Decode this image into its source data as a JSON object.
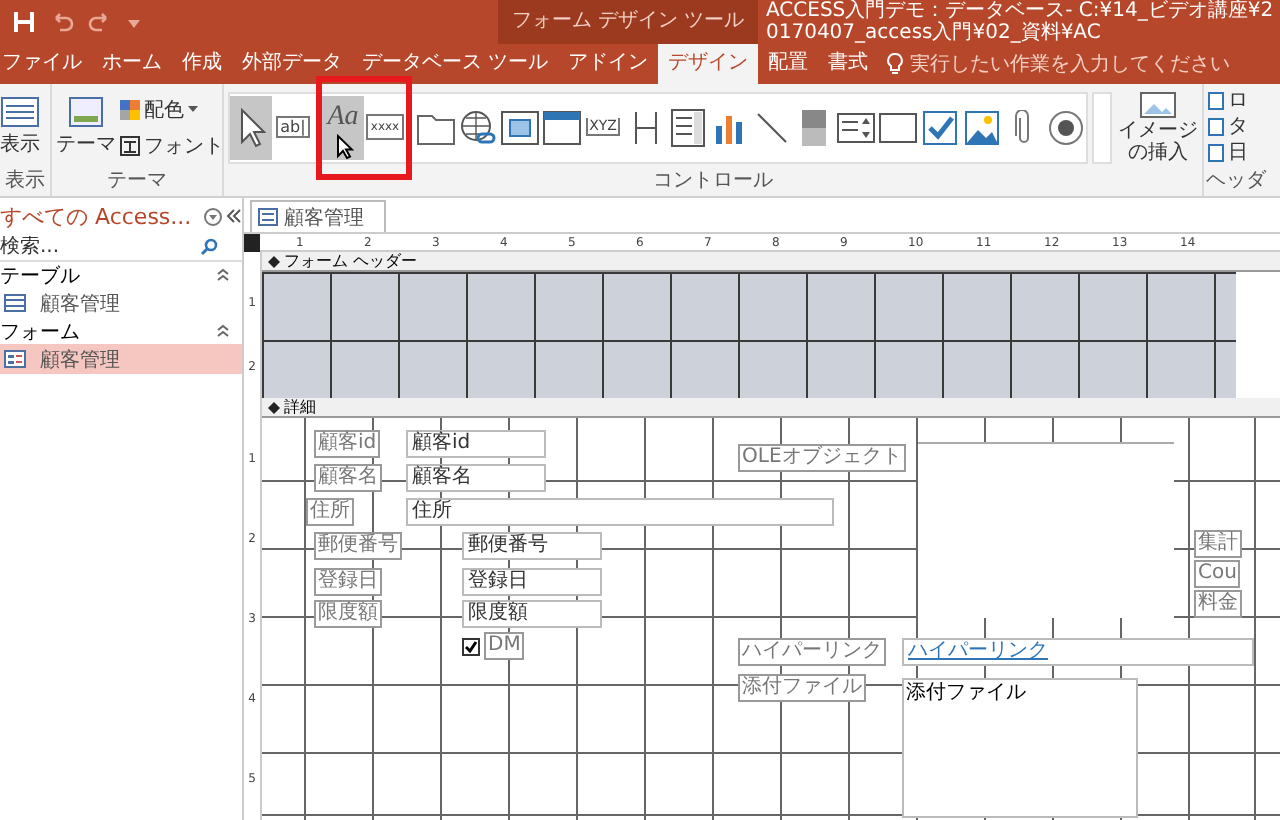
{
  "title_bar": {
    "context_title": "フォーム デザイン ツール",
    "document_title": "ACCESS入門デモ：データベース- C:¥14_ビデオ講座¥20170407_access入門¥02_資料¥AC"
  },
  "menu_tabs": [
    {
      "label": "ファイル",
      "selected": false
    },
    {
      "label": "ホーム",
      "selected": false
    },
    {
      "label": "作成",
      "selected": false
    },
    {
      "label": "外部データ",
      "selected": false
    },
    {
      "label": "データベース ツール",
      "selected": false
    },
    {
      "label": "アドイン",
      "selected": false
    },
    {
      "label": "デザイン",
      "selected": true
    },
    {
      "label": "配置",
      "selected": false
    },
    {
      "label": "書式",
      "selected": false
    }
  ],
  "tell_me": {
    "placeholder": "実行したい作業を入力してください"
  },
  "ribbon": {
    "view_group": {
      "button": "表示",
      "label": "表示"
    },
    "theme_group": {
      "theme_button": "テーマ",
      "colors_button": "配色",
      "fonts_button": "フォント",
      "label": "テーマ"
    },
    "controls_group": {
      "label": "コントロール",
      "items": [
        {
          "kind": "select",
          "selected": true,
          "highlighted": false,
          "hovered": false
        },
        {
          "kind": "textbox",
          "glyph": "ab|",
          "selected": false,
          "highlighted": false,
          "hovered": false
        },
        {
          "kind": "label",
          "glyph": "Aa",
          "selected": true,
          "highlighted": true,
          "hovered": true
        },
        {
          "kind": "button",
          "glyph": "xxxx",
          "selected": false,
          "highlighted": true,
          "hovered": false
        },
        {
          "kind": "tab",
          "selected": false,
          "highlighted": false,
          "hovered": false
        },
        {
          "kind": "hyperlink",
          "selected": false,
          "highlighted": false,
          "hovered": false
        },
        {
          "kind": "browser",
          "selected": false,
          "highlighted": false,
          "hovered": false
        },
        {
          "kind": "navigation",
          "selected": false,
          "highlighted": false,
          "hovered": false
        },
        {
          "kind": "option_group",
          "glyph": "XYZ",
          "selected": false,
          "highlighted": false,
          "hovered": false
        },
        {
          "kind": "page_break",
          "selected": false,
          "highlighted": false,
          "hovered": false
        },
        {
          "kind": "combo",
          "selected": false,
          "highlighted": false,
          "hovered": false
        },
        {
          "kind": "chart",
          "selected": false,
          "highlighted": false,
          "hovered": false
        },
        {
          "kind": "line",
          "selected": false,
          "highlighted": false,
          "hovered": false
        },
        {
          "kind": "toggle",
          "selected": false,
          "highlighted": false,
          "hovered": false
        },
        {
          "kind": "list",
          "selected": false,
          "highlighted": false,
          "hovered": false
        },
        {
          "kind": "rectangle",
          "selected": false,
          "highlighted": false,
          "hovered": false
        },
        {
          "kind": "checkbox",
          "selected": false,
          "highlighted": false,
          "hovered": false
        },
        {
          "kind": "image",
          "selected": false,
          "highlighted": false,
          "hovered": false
        },
        {
          "kind": "attachment",
          "selected": false,
          "highlighted": false,
          "hovered": false
        },
        {
          "kind": "radio",
          "selected": false,
          "highlighted": false,
          "hovered": false
        }
      ],
      "insert_image_button": "イメージの挿入"
    },
    "header_group": {
      "label": "ヘッダ",
      "items": [
        "ロ",
        "タ",
        "日"
      ]
    }
  },
  "nav_pane": {
    "title": "すべての Access...",
    "search": {
      "placeholder": "検索..."
    },
    "groups": [
      {
        "label": "テーブル",
        "expanded": true,
        "items": [
          {
            "label": "顧客管理",
            "kind": "table",
            "selected": false
          }
        ]
      },
      {
        "label": "フォーム",
        "expanded": true,
        "items": [
          {
            "label": "顧客管理",
            "kind": "form",
            "selected": true
          }
        ]
      }
    ]
  },
  "document_tab": {
    "label": "顧客管理"
  },
  "ruler": {
    "horizontal": [
      "1",
      "2",
      "3",
      "4",
      "5",
      "6",
      "7",
      "8",
      "9",
      "10",
      "11",
      "12",
      "13",
      "14"
    ],
    "header": [
      "1",
      "2"
    ],
    "detail": [
      "1",
      "2",
      "3",
      "4",
      "5"
    ]
  },
  "form": {
    "header_section": "フォーム ヘッダー",
    "detail_section": "詳細",
    "controls": [
      {
        "kind": "label",
        "text": "顧客id"
      },
      {
        "kind": "textbox",
        "text": "顧客id"
      },
      {
        "kind": "label",
        "text": "顧客名"
      },
      {
        "kind": "textbox",
        "text": "顧客名"
      },
      {
        "kind": "label",
        "text": "住所"
      },
      {
        "kind": "textbox",
        "text": "住所"
      },
      {
        "kind": "label",
        "text": "郵便番号"
      },
      {
        "kind": "textbox",
        "text": "郵便番号"
      },
      {
        "kind": "label",
        "text": "登録日"
      },
      {
        "kind": "textbox",
        "text": "登録日"
      },
      {
        "kind": "label",
        "text": "限度額"
      },
      {
        "kind": "textbox",
        "text": "限度額"
      },
      {
        "kind": "checkbox",
        "text": "DM",
        "checked": true
      },
      {
        "kind": "label",
        "text": "OLEオブジェクト"
      },
      {
        "kind": "frame"
      },
      {
        "kind": "label",
        "text": "集計"
      },
      {
        "kind": "label",
        "text": "Cou"
      },
      {
        "kind": "label",
        "text": "料金"
      },
      {
        "kind": "label",
        "text": "ハイパーリンク"
      },
      {
        "kind": "link",
        "text": "ハイパーリンク"
      },
      {
        "kind": "label",
        "text": "添付ファイル"
      },
      {
        "kind": "attachment",
        "text": "添付ファイル"
      }
    ]
  }
}
